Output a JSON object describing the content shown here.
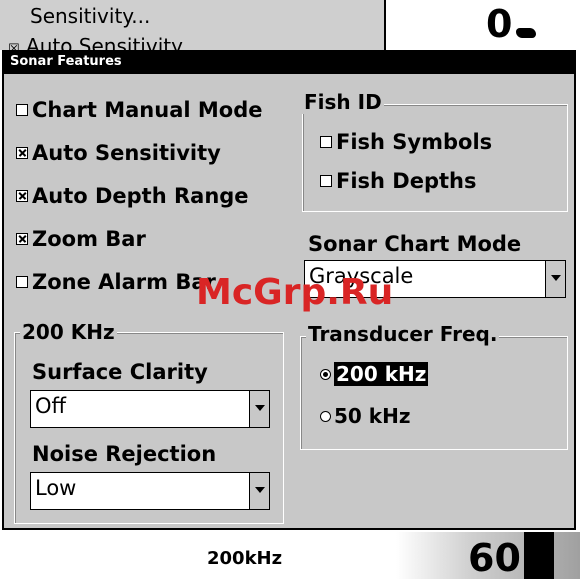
{
  "background": {
    "menu_item_1": "Sensitivity...",
    "menu_item_2": "Auto Sensitivity",
    "depth_top": "0",
    "bottom_freq": "200kHz",
    "bottom_depth": "60"
  },
  "dialog": {
    "title": "Sonar Features",
    "checkboxes": [
      {
        "label": "Chart Manual Mode",
        "checked": false
      },
      {
        "label": "Auto Sensitivity",
        "checked": true
      },
      {
        "label": "Auto Depth Range",
        "checked": true
      },
      {
        "label": "Zoom Bar",
        "checked": true
      },
      {
        "label": "Zone Alarm Bar",
        "checked": false
      }
    ],
    "fish_id": {
      "label": "Fish ID",
      "options": [
        {
          "label": "Fish Symbols",
          "checked": false
        },
        {
          "label": "Fish Depths",
          "checked": false
        }
      ]
    },
    "sonar_chart_mode": {
      "label": "Sonar Chart Mode",
      "value": "Grayscale"
    },
    "freq_group": {
      "label": "200 KHz",
      "surface_clarity": {
        "label": "Surface Clarity",
        "value": "Off"
      },
      "noise_rejection": {
        "label": "Noise Rejection",
        "value": "Low"
      }
    },
    "transducer": {
      "label": "Transducer Freq.",
      "options": [
        {
          "label": "200 kHz",
          "selected": true
        },
        {
          "label": "50 kHz",
          "selected": false
        }
      ]
    }
  },
  "watermark": "McGrp.Ru"
}
